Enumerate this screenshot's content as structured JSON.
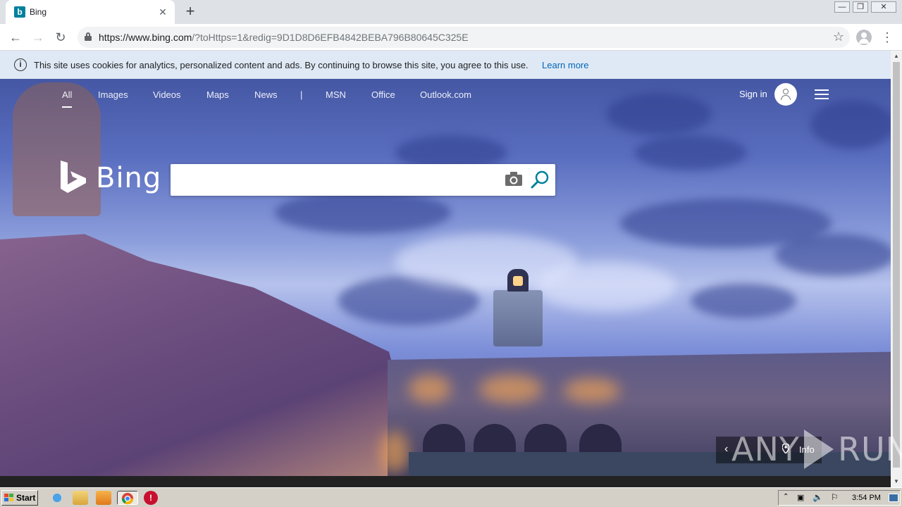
{
  "browser": {
    "tab_title": "Bing",
    "tab_close": "✕",
    "new_tab": "+",
    "url_host": "https://www.bing.com",
    "url_rest": "/?toHttps=1&redig=9D1D8D6EFB4842BEBA796B80645C325E"
  },
  "cookie_banner": {
    "message": "This site uses cookies for analytics, personalized content and ads. By continuing to browse this site, you agree to this use.",
    "learn_more": "Learn more"
  },
  "bing": {
    "nav": [
      "All",
      "Images",
      "Videos",
      "Maps",
      "News",
      "|",
      "MSN",
      "Office",
      "Outlook.com"
    ],
    "sign_in": "Sign in",
    "logo_word": "Bing",
    "search_value": "",
    "info_label": "Info"
  },
  "watermark": {
    "left": "ANY",
    "right": "RUN"
  },
  "taskbar": {
    "start_label": "Start",
    "clock": "3:54 PM"
  },
  "colors": {
    "bing_teal": "#00809d",
    "link_blue": "#0066b8",
    "banner_bg": "#dfe9f5"
  }
}
